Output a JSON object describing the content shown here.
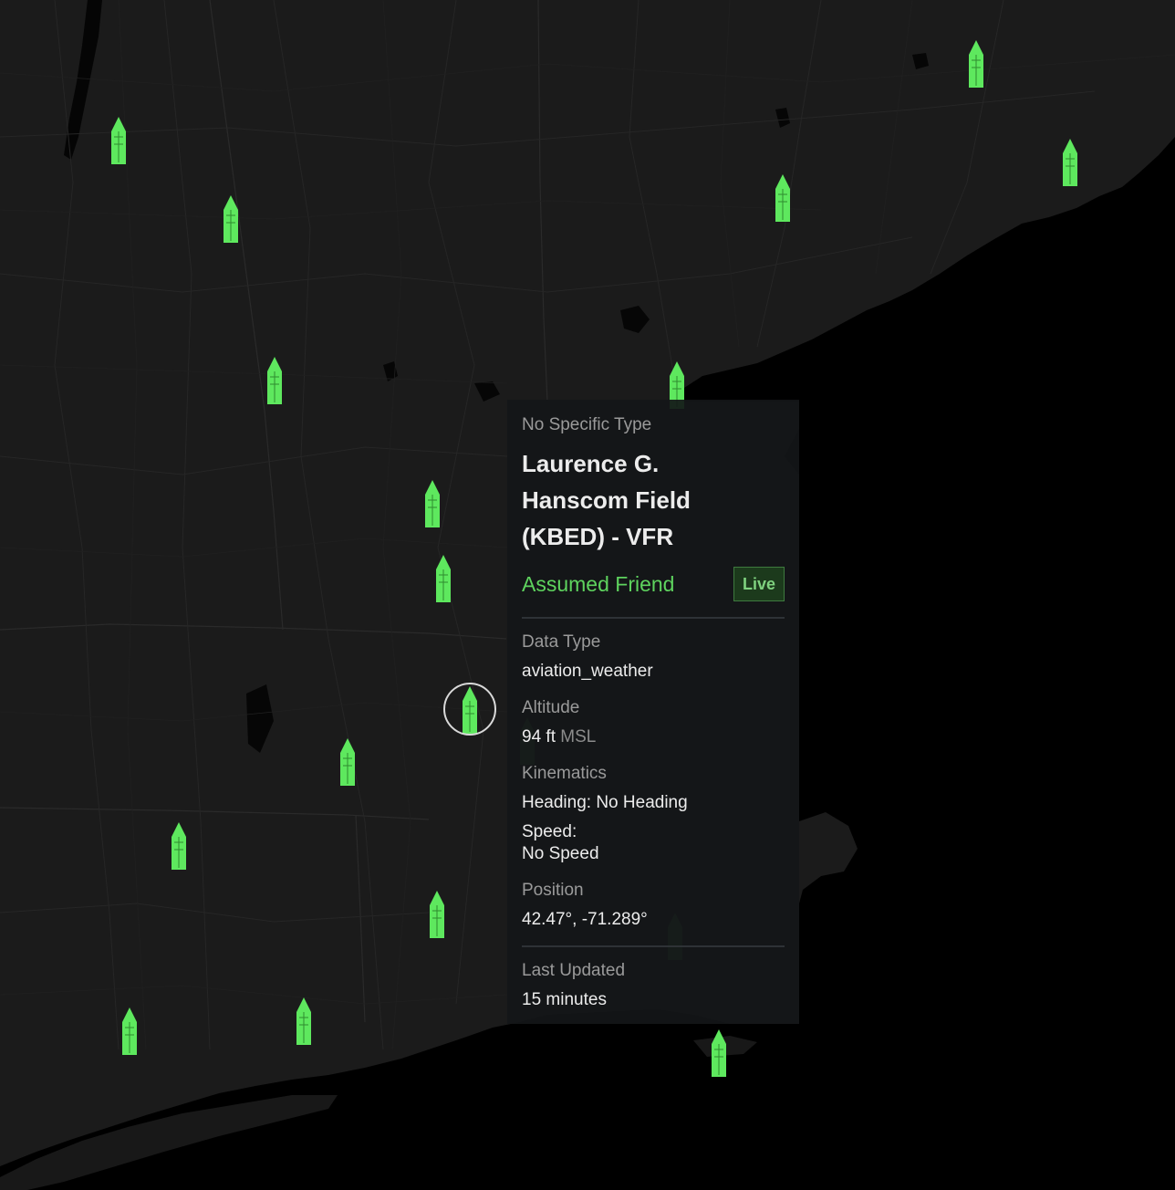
{
  "map": {
    "accent_color": "#5ee85e",
    "land_color": "#1b1b1b",
    "water_color": "#000000",
    "marker_icon": "weather-station-marker",
    "marker_count": 18,
    "selected_marker": "laurence-g-hanscom-field"
  },
  "popup": {
    "type_label": "No Specific Type",
    "title": "Laurence G. Hanscom Field (KBED) - VFR",
    "affiliation": "Assumed Friend",
    "live_badge": "Live",
    "data_type_label": "Data Type",
    "data_type_value": "aviation_weather",
    "altitude_label": "Altitude",
    "altitude_value": "94 ft",
    "altitude_unit": "MSL",
    "kinematics_label": "Kinematics",
    "heading_text": "Heading: No Heading",
    "speed_label": "Speed:",
    "speed_value": "No Speed",
    "position_label": "Position",
    "position_value": "42.47°, -71.289°",
    "last_updated_label": "Last Updated",
    "last_updated_value": "15 minutes"
  }
}
